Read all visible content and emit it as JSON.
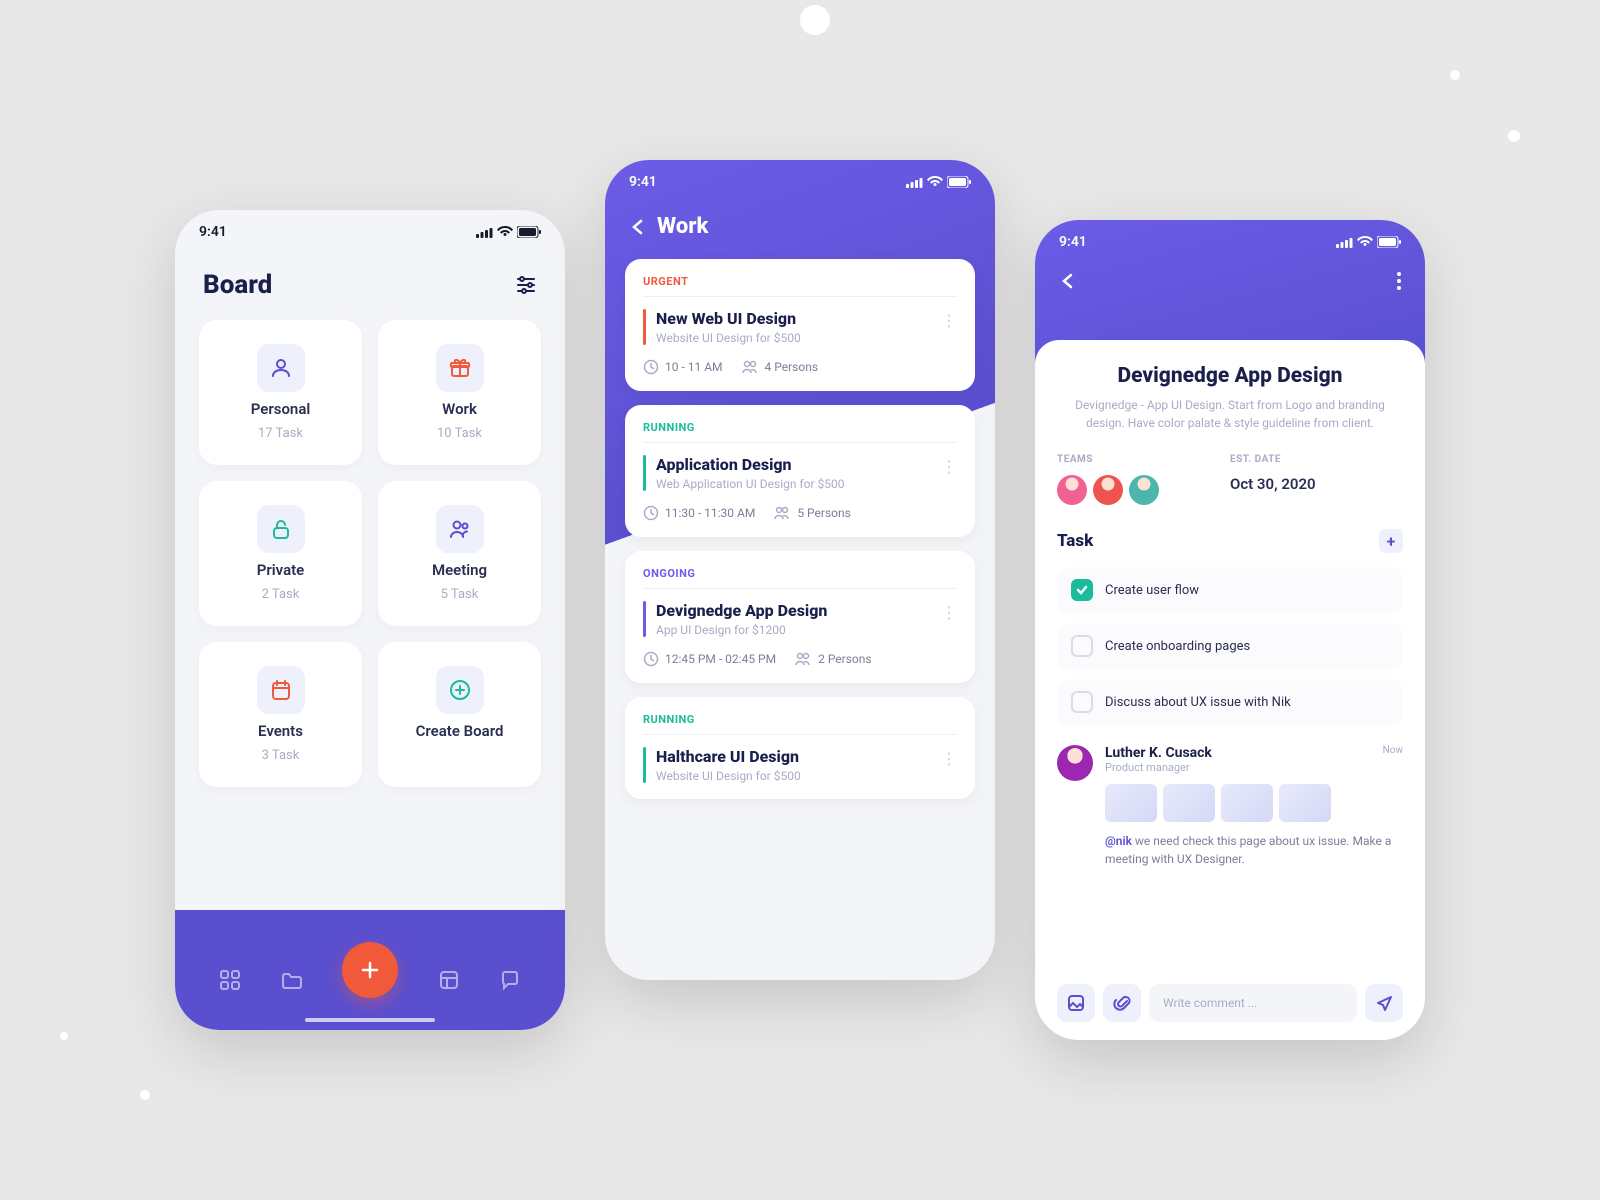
{
  "status_time": "9:41",
  "screen1": {
    "title": "Board",
    "cards": [
      {
        "name": "Personal",
        "sub": "17 Task"
      },
      {
        "name": "Work",
        "sub": "10 Task"
      },
      {
        "name": "Private",
        "sub": "2 Task"
      },
      {
        "name": "Meeting",
        "sub": "5 Task"
      },
      {
        "name": "Events",
        "sub": "3 Task"
      },
      {
        "name": "Create Board",
        "sub": ""
      }
    ]
  },
  "screen2": {
    "title": "Work",
    "items": [
      {
        "section": "URGENT",
        "title": "New Web UI Design",
        "sub": "Website UI Design for $500",
        "time": "10 - 11 AM",
        "persons": "4 Persons",
        "color": "#f05a3b"
      },
      {
        "section": "RUNNING",
        "title": "Application Design",
        "sub": "Web Application UI Design for $500",
        "time": "11:30 - 11:30 AM",
        "persons": "5 Persons",
        "color": "#1abc9c"
      },
      {
        "section": "ONGOING",
        "title": "Devignedge App Design",
        "sub": "App UI Design for $1200",
        "time": "12:45 PM - 02:45 PM",
        "persons": "2 Persons",
        "color": "#6c5ce7"
      },
      {
        "section": "RUNNING",
        "title": "Halthcare UI Design",
        "sub": "Website UI Design for $500",
        "time": "",
        "persons": "",
        "color": "#1abc9c"
      }
    ]
  },
  "screen3": {
    "title": "Devignedge App Design",
    "desc": "Devignedge - App UI Design. Start from Logo and branding design. Have color palate & style guideline from client.",
    "teams_label": "TEAMS",
    "date_label": "EST. DATE",
    "date": "Oct 30, 2020",
    "task_label": "Task",
    "tasks": [
      {
        "done": true,
        "text": "Create user flow"
      },
      {
        "done": false,
        "text": "Create onboarding pages"
      },
      {
        "done": false,
        "text": "Discuss about UX issue with Nik"
      }
    ],
    "comment": {
      "name": "Luther K. Cusack",
      "role": "Product manager",
      "time": "Now",
      "mention": "@nik",
      "text": " we need check this page about ux issue. Make a meeting with UX Designer."
    },
    "input_placeholder": "Write comment ..."
  }
}
